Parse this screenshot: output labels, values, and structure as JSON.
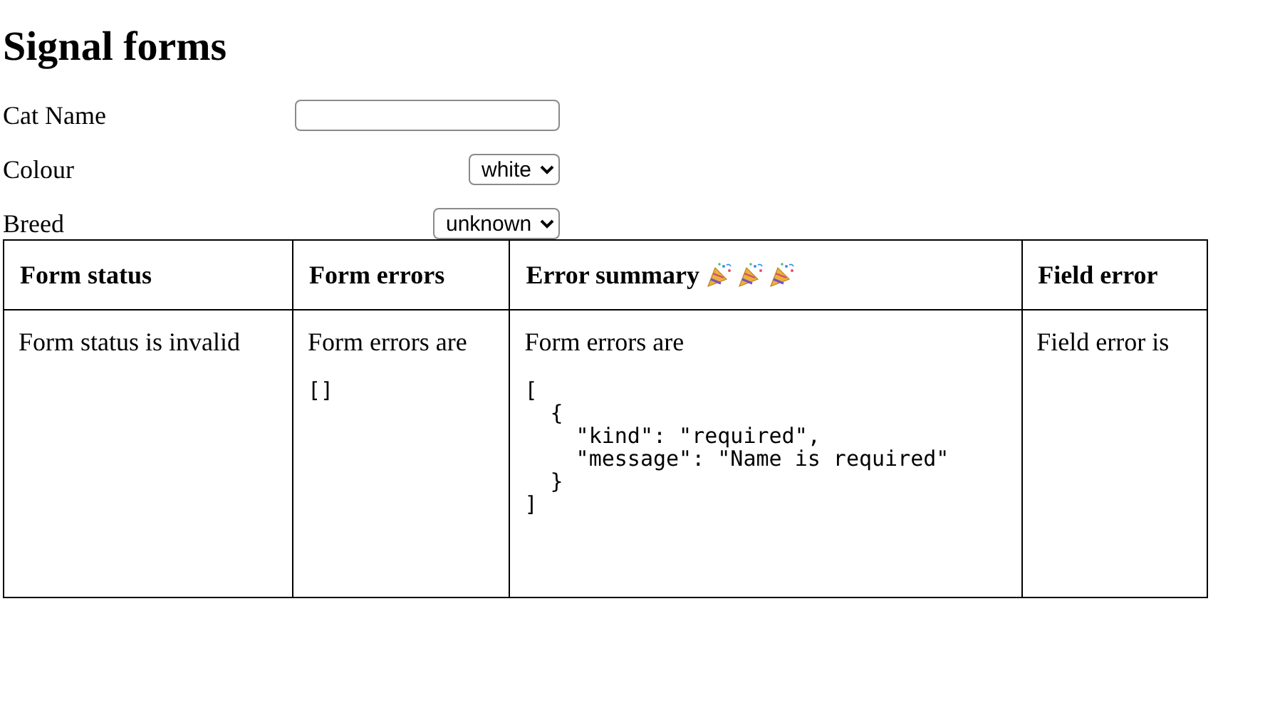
{
  "title": "Signal forms",
  "fields": [
    {
      "label": "Cat Name",
      "kind": "text"
    },
    {
      "label": "Colour",
      "kind": "select",
      "value": "white"
    },
    {
      "label": "Breed",
      "kind": "select",
      "value": "unknown"
    }
  ],
  "table": {
    "columns": [
      {
        "label": "Form status"
      },
      {
        "label": "Form errors"
      },
      {
        "label": "Error summary",
        "party_poppers": true
      },
      {
        "label": "Field error"
      }
    ],
    "rows": [
      {
        "cells": [
          {
            "text": "Form status is invalid"
          },
          {
            "text": "Form errors are",
            "code": "[]"
          },
          {
            "text": "Form errors are",
            "code": "[\n  {\n    \"kind\": \"required\",\n    \"message\": \"Name is required\"\n  }\n]"
          },
          {
            "text": "Field error is"
          }
        ]
      }
    ]
  }
}
